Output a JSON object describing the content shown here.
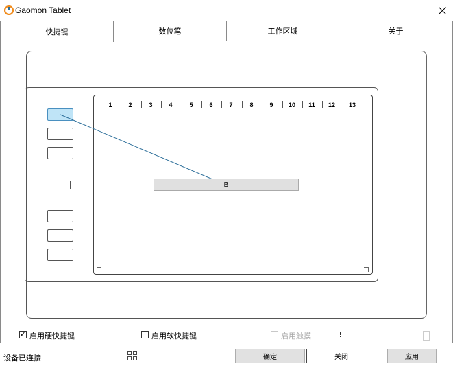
{
  "window": {
    "title": "Gaomon Tablet",
    "close_icon": "close-icon",
    "app_icon": "gaomon-logo-icon"
  },
  "tabs": [
    {
      "label": "快捷键",
      "active": true
    },
    {
      "label": "数位笔",
      "active": false
    },
    {
      "label": "工作区域",
      "active": false
    },
    {
      "label": "关于",
      "active": false
    }
  ],
  "tablet": {
    "ruler": [
      "1",
      "2",
      "3",
      "4",
      "5",
      "6",
      "7",
      "8",
      "9",
      "10",
      "11",
      "12",
      "13"
    ],
    "assigned_key": "B",
    "selected_key_index": 0
  },
  "options": {
    "hard_keys": {
      "label": "启用硬快捷键",
      "checked": true
    },
    "soft_keys": {
      "label": "启用软快捷键",
      "checked": false
    },
    "touch": {
      "label": "启用触摸",
      "checked": false,
      "disabled": true
    }
  },
  "status": {
    "text": "设备已连接",
    "grid_icon": "grid-icon"
  },
  "buttons": {
    "ok": "确定",
    "close": "关闭",
    "apply": "应用"
  },
  "colors": {
    "selected_key": "#bfe4f7",
    "connector_line": "#2d6f9a",
    "assign_box": "#e0e0e0"
  }
}
